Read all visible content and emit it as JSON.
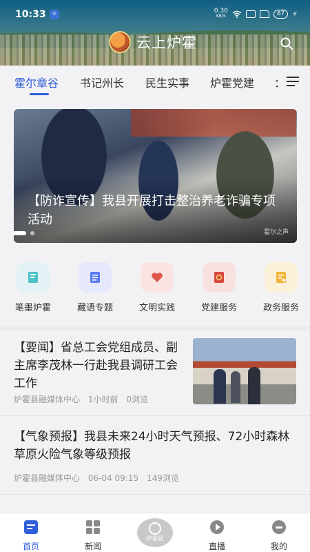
{
  "status_bar": {
    "time": "10:33",
    "net_speed_value": "0.30",
    "net_speed_unit": "KB/S",
    "battery": "87"
  },
  "header": {
    "app_title": "云上炉霍"
  },
  "channels": {
    "items": [
      "霍尔章谷",
      "书记州长",
      "民生实事",
      "炉霍党建",
      "："
    ],
    "active": "霍尔章谷"
  },
  "banner": {
    "title": "【防诈宣传】我县开展打击整治养老诈骗专项活动",
    "watermark": "霍尔之声",
    "slide_current": 1,
    "slide_count": 2
  },
  "shortcuts": [
    {
      "label": "笔墨炉霍",
      "icon": "book-icon",
      "color": "#4cc3c8",
      "bg": "#e3f3f5"
    },
    {
      "label": "藏语专题",
      "icon": "document-icon",
      "color": "#5b7cf0",
      "bg": "#e6e9fb"
    },
    {
      "label": "文明实践",
      "icon": "heart-icon",
      "color": "#e0574b",
      "bg": "#f9e4e2"
    },
    {
      "label": "党建服务",
      "icon": "party-flag-icon",
      "color": "#d9483f",
      "bg": "#f8e2e0"
    },
    {
      "label": "政务服务",
      "icon": "government-doc-icon",
      "color": "#f0b43a",
      "bg": "#fbf0d8"
    }
  ],
  "news": [
    {
      "title": "【要闻】省总工会党组成员、副主席李茂林一行赴我县调研工会工作",
      "source": "炉霍县融媒体中心",
      "time": "1小时前",
      "views": "0浏览"
    },
    {
      "title": "【气象预报】我县未来24小时天气预报、72小时森林草原火险气象等级预报",
      "source": "炉霍县融媒体中心",
      "time": "06-04 09:15",
      "views": "149浏览"
    }
  ],
  "bottom_nav": {
    "items": [
      "首页",
      "新闻",
      "炉霍圈",
      "直播",
      "我的"
    ],
    "active": "首页"
  },
  "colors": {
    "accent": "#2f5fd9"
  }
}
